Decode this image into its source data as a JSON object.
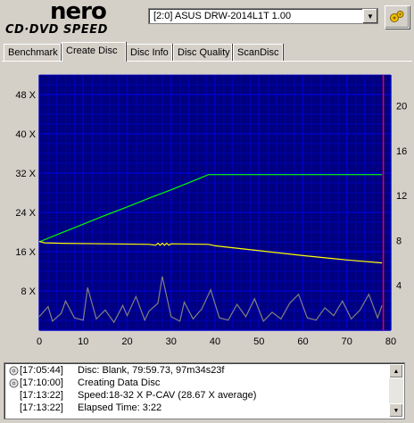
{
  "header": {
    "logo_brand": "nero",
    "logo_product": "CD·DVD SPEED",
    "drive_selected": "[2:0]  ASUS DRW-2014L1T 1.00"
  },
  "tabs": [
    {
      "label": "Benchmark",
      "active": false
    },
    {
      "label": "Create Disc",
      "active": true
    },
    {
      "label": "Disc Info",
      "active": false
    },
    {
      "label": "Disc Quality",
      "active": false
    },
    {
      "label": "ScanDisc",
      "active": false
    }
  ],
  "colors": {
    "plot_bg": "#000080",
    "grid": "#0000c8",
    "write_speed": "#00ff00",
    "rpm": "#ffff00",
    "cpu": "#808080",
    "end_marker": "#ff0000"
  },
  "chart_data": {
    "type": "line",
    "x_range": [
      0,
      80
    ],
    "x_ticks": [
      0,
      10,
      20,
      30,
      40,
      50,
      60,
      70,
      80
    ],
    "left_range": [
      0,
      52
    ],
    "left_ticks": [
      "8 X",
      "16 X",
      "24 X",
      "32 X",
      "40 X",
      "48 X"
    ],
    "left_tick_values": [
      8,
      16,
      24,
      32,
      40,
      48
    ],
    "right_range": [
      0,
      22.75
    ],
    "right_ticks": [
      4,
      8,
      12,
      16,
      20
    ],
    "grid": true,
    "end_marker_x": 78.3,
    "series": [
      {
        "key": "write",
        "x": [
          0,
          5,
          10,
          15,
          20,
          25,
          30,
          35,
          38.5,
          45,
          50,
          60,
          70,
          78
        ],
        "y": [
          18,
          19.8,
          21.6,
          23.4,
          25.1,
          26.9,
          28.6,
          30.4,
          31.7,
          31.7,
          31.7,
          31.7,
          31.7,
          31.7
        ]
      },
      {
        "key": "speed",
        "x": [
          0,
          1.2,
          5,
          15,
          25,
          26.5,
          27,
          27.5,
          28,
          28.5,
          29,
          29.5,
          30,
          38.5,
          40,
          50,
          60,
          70,
          78
        ],
        "y": [
          18.1,
          17.8,
          17.7,
          17.6,
          17.5,
          17.3,
          17.7,
          17.3,
          17.7,
          17.3,
          17.7,
          17.3,
          17.6,
          17.5,
          17.2,
          16.2,
          15.2,
          14.3,
          13.7
        ]
      },
      {
        "key": "cpu",
        "x": [
          0,
          2,
          3,
          5,
          6,
          8,
          10,
          11,
          13,
          15,
          17,
          19,
          20,
          22,
          24,
          25,
          27,
          28,
          30,
          32,
          33,
          35,
          37,
          39,
          41,
          43,
          45,
          47,
          49,
          51,
          53,
          55,
          57,
          59,
          61,
          63,
          65,
          67,
          69,
          71,
          73,
          75,
          77,
          78
        ],
        "y": [
          1.2,
          2.1,
          0.8,
          1.5,
          2.6,
          1.1,
          0.9,
          3.8,
          1.0,
          1.8,
          0.7,
          2.2,
          1.3,
          3.0,
          0.9,
          1.7,
          2.4,
          4.8,
          1.2,
          0.8,
          2.5,
          1.0,
          1.9,
          3.6,
          1.1,
          0.9,
          2.3,
          1.2,
          2.8,
          0.8,
          1.6,
          1.0,
          2.4,
          3.2,
          1.1,
          0.9,
          2.0,
          1.3,
          2.6,
          1.0,
          1.8,
          3.2,
          1.1,
          2.2
        ]
      }
    ]
  },
  "log": [
    {
      "time": "[17:05:44]",
      "msg": "Disc: Blank, 79:59.73, 97m34s23f",
      "icon": "disc-icon"
    },
    {
      "time": "[17:10:00]",
      "msg": "Creating Data Disc",
      "icon": "disc-icon"
    },
    {
      "time": "[17:13:22]",
      "msg": "Speed:18-32 X P-CAV (28.67 X average)",
      "icon": ""
    },
    {
      "time": "[17:13:22]",
      "msg": "Elapsed Time:  3:22",
      "icon": ""
    }
  ]
}
